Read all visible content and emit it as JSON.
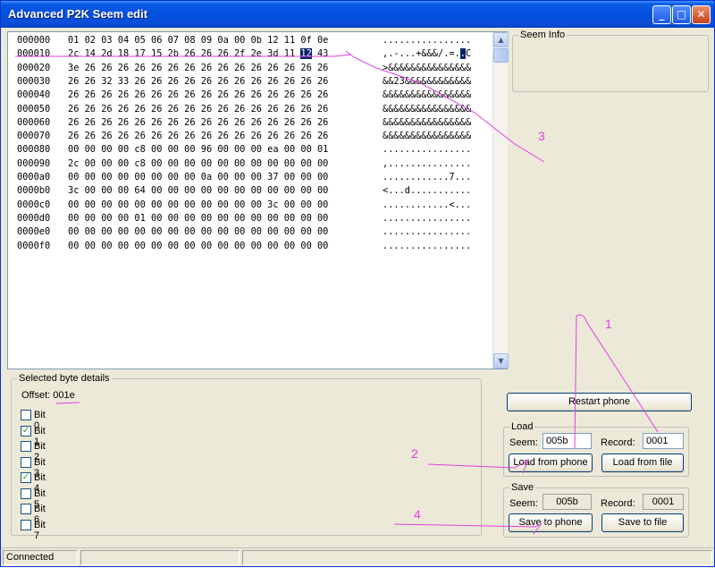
{
  "window": {
    "title": "Advanced P2K Seem edit"
  },
  "titlebar": {
    "minimize_icon": "minimize-icon",
    "maximize_icon": "maximize-icon",
    "close_icon": "close-icon",
    "minimize_glyph": "_",
    "maximize_glyph": "□",
    "close_glyph": "✕"
  },
  "hex": {
    "rows": [
      {
        "addr": "000000",
        "bytes": "01 02 03 04 05 06 07 08 09 0a 00 0b 12 11 0f 0e",
        "ascii": "................"
      },
      {
        "addr": "000010",
        "bytes_pre": "2c 14 2d 18 17 15 2b 26 26 26 2f 2e 3d 11 ",
        "bytes_sel": "12",
        "bytes_post": " 43",
        "ascii_pre": ",.-...+&&&/.=.",
        "ascii_sel": ".",
        "ascii_post": "C"
      },
      {
        "addr": "000020",
        "bytes": "3e 26 26 26 26 26 26 26 26 26 26 26 26 26 26 26",
        "ascii": ">&&&&&&&&&&&&&&&"
      },
      {
        "addr": "000030",
        "bytes": "26 26 32 33 26 26 26 26 26 26 26 26 26 26 26 26",
        "ascii": "&&23&&&&&&&&&&&&"
      },
      {
        "addr": "000040",
        "bytes": "26 26 26 26 26 26 26 26 26 26 26 26 26 26 26 26",
        "ascii": "&&&&&&&&&&&&&&&&"
      },
      {
        "addr": "000050",
        "bytes": "26 26 26 26 26 26 26 26 26 26 26 26 26 26 26 26",
        "ascii": "&&&&&&&&&&&&&&&&"
      },
      {
        "addr": "000060",
        "bytes": "26 26 26 26 26 26 26 26 26 26 26 26 26 26 26 26",
        "ascii": "&&&&&&&&&&&&&&&&"
      },
      {
        "addr": "000070",
        "bytes": "26 26 26 26 26 26 26 26 26 26 26 26 26 26 26 26",
        "ascii": "&&&&&&&&&&&&&&&&"
      },
      {
        "addr": "000080",
        "bytes": "00 00 00 00 c8 00 00 00 96 00 00 00 ea 00 00 01",
        "ascii": "................"
      },
      {
        "addr": "000090",
        "bytes": "2c 00 00 00 c8 00 00 00 00 00 00 00 00 00 00 00",
        "ascii": ",..............."
      },
      {
        "addr": "0000a0",
        "bytes": "00 00 00 00 00 00 00 00 0a 00 00 00 37 00 00 00",
        "ascii": "............7..."
      },
      {
        "addr": "0000b0",
        "bytes": "3c 00 00 00 64 00 00 00 00 00 00 00 00 00 00 00",
        "ascii": "<...d..........."
      },
      {
        "addr": "0000c0",
        "bytes": "00 00 00 00 00 00 00 00 00 00 00 00 3c 00 00 00",
        "ascii": "............<..."
      },
      {
        "addr": "0000d0",
        "bytes": "00 00 00 00 01 00 00 00 00 00 00 00 00 00 00 00",
        "ascii": "................"
      },
      {
        "addr": "0000e0",
        "bytes": "00 00 00 00 00 00 00 00 00 00 00 00 00 00 00 00",
        "ascii": "................"
      },
      {
        "addr": "0000f0",
        "bytes": "00 00 00 00 00 00 00 00 00 00 00 00 00 00 00 00",
        "ascii": "................"
      }
    ]
  },
  "seem_info": {
    "legend": "Seem Info"
  },
  "details": {
    "legend": "Selected byte details",
    "offset_label": "Offset: ",
    "offset_value": "001e",
    "bits": [
      {
        "label": "Bit 0",
        "checked": false
      },
      {
        "label": "Bit 1",
        "checked": true
      },
      {
        "label": "Bit 2",
        "checked": false
      },
      {
        "label": "Bit 3",
        "checked": false
      },
      {
        "label": "Bit 4",
        "checked": true
      },
      {
        "label": "Bit 5",
        "checked": false
      },
      {
        "label": "Bit 6",
        "checked": false
      },
      {
        "label": "Bit 7",
        "checked": false
      }
    ]
  },
  "actions": {
    "restart_label": "Restart phone"
  },
  "load": {
    "legend": "Load",
    "seem_label": "Seem:",
    "seem_value": "005b",
    "record_label": "Record:",
    "record_value": "0001",
    "from_phone_label": "Load from phone",
    "from_file_label": "Load from file"
  },
  "save": {
    "legend": "Save",
    "seem_label": "Seem:",
    "seem_value": "005b",
    "record_label": "Record:",
    "record_value": "0001",
    "to_phone_label": "Save to phone",
    "to_file_label": "Save to file"
  },
  "status": {
    "text": "Connected"
  },
  "annotations": {
    "n1": "1",
    "n2": "2",
    "n3": "3",
    "n4": "4",
    "color": "#e040e0"
  }
}
